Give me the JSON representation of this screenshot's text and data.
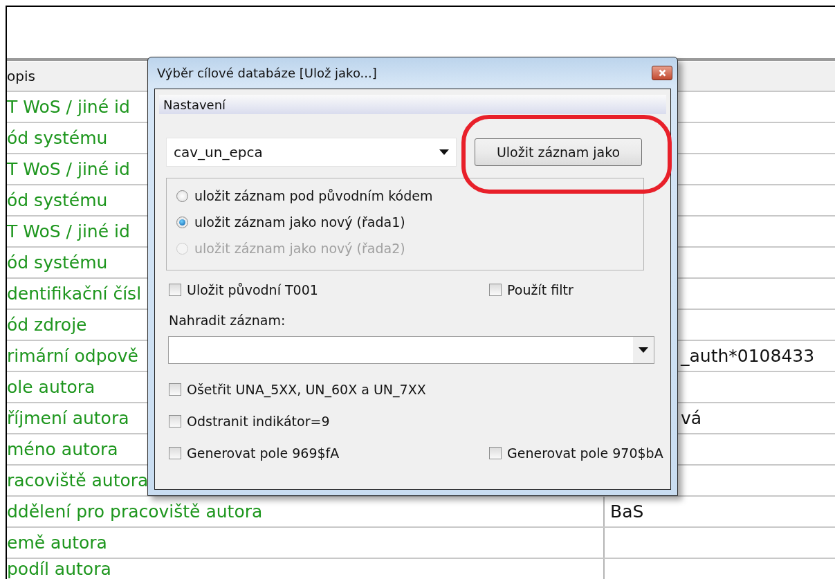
{
  "table": {
    "columns": [
      "opis"
    ],
    "rows": [
      {
        "label": "T WoS / jiné id",
        "value": ""
      },
      {
        "label": "ód systému",
        "value": ""
      },
      {
        "label": "T WoS / jiné id",
        "value": ""
      },
      {
        "label": "ód systému",
        "value": ""
      },
      {
        "label": "T WoS / jiné id",
        "value": ""
      },
      {
        "label": "ód systému",
        "value": ""
      },
      {
        "label": "dentifikační čísl",
        "value": ""
      },
      {
        "label": "ód zdroje",
        "value": ""
      },
      {
        "label": "rimární odpově",
        "value": "_auth*0108433"
      },
      {
        "label": "ole autora",
        "value": ""
      },
      {
        "label": "říjmení autora",
        "value": "vá"
      },
      {
        "label": "méno autora",
        "value": ""
      },
      {
        "label": "racoviště autora",
        "value": ""
      },
      {
        "label": "ddělení pro pracoviště autora",
        "value": "BaS"
      },
      {
        "label": "emě autora",
        "value": ""
      },
      {
        "label": "podíl autora",
        "value": ""
      }
    ]
  },
  "dialog": {
    "title": "Výběr cílové databáze [Ulož jako...]",
    "section": "Nastavení",
    "database": {
      "value": "cav_un_epca"
    },
    "save_button": "Uložit záznam jako",
    "radios": [
      {
        "label": "uložit záznam pod původním kódem",
        "selected": false,
        "disabled": false
      },
      {
        "label": "uložit záznam jako nový (řada1)",
        "selected": true,
        "disabled": false
      },
      {
        "label": "uložit záznam jako nový (řada2)",
        "selected": false,
        "disabled": true
      }
    ],
    "top_options": [
      {
        "label": "Uložit původní T001",
        "checked": false
      },
      {
        "label": "Použít filtr",
        "checked": false
      }
    ],
    "replace": {
      "label": "Nahradit záznam:"
    },
    "options": [
      [
        {
          "label": "Ošetřit UNA_5XX, UN_60X a UN_7XX",
          "checked": false
        }
      ],
      [
        {
          "label": "Odstranit indikátor=9",
          "checked": false
        }
      ],
      [
        {
          "label": "Generovat pole 969$fA",
          "checked": false
        },
        {
          "label": "Generovat pole 970$bA",
          "checked": false
        }
      ]
    ]
  }
}
